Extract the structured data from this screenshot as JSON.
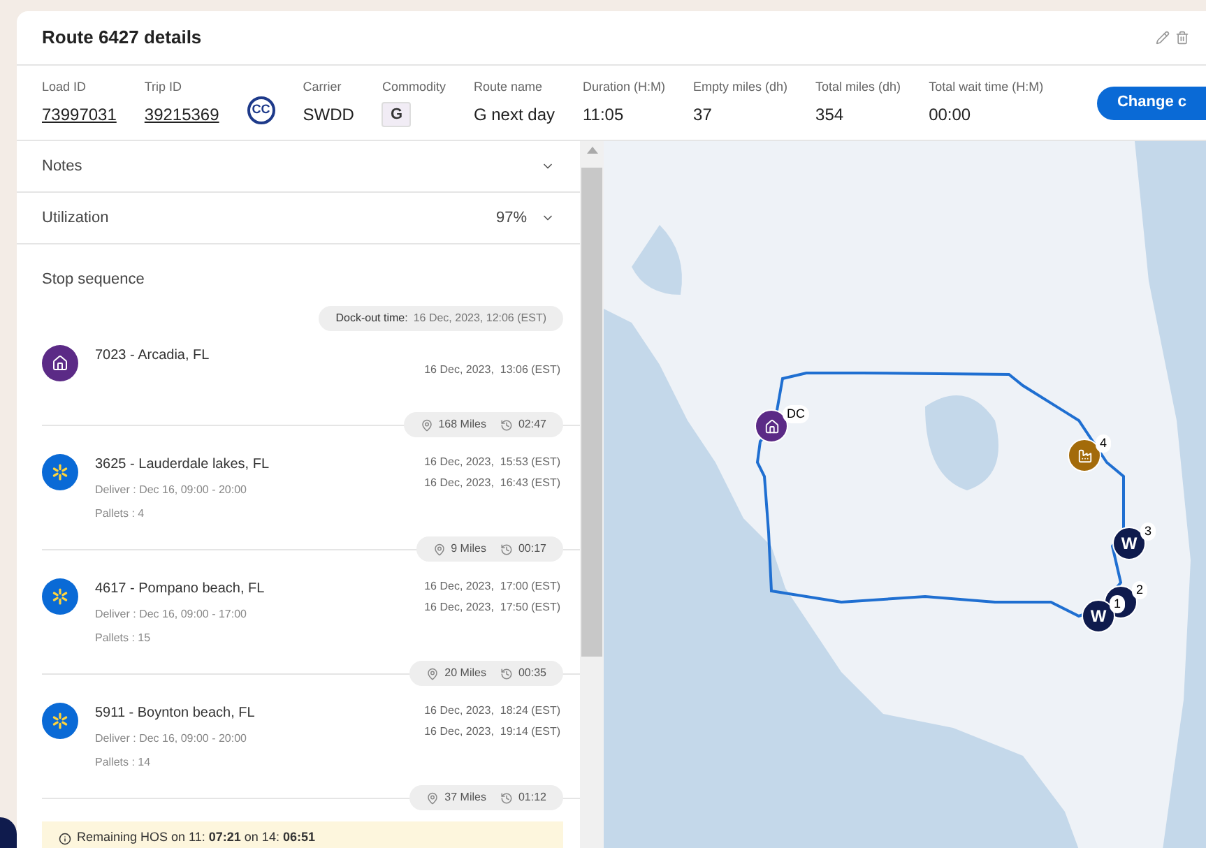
{
  "header": {
    "title": "Route 6427 details",
    "fields": [
      {
        "kind": "link",
        "label": "Load ID",
        "value": "73997031"
      },
      {
        "kind": "link",
        "label": "Trip ID",
        "value": "39215369"
      },
      {
        "kind": "logo",
        "value": "CC"
      },
      {
        "kind": "text",
        "label": "Carrier",
        "value": "SWDD"
      },
      {
        "kind": "badge",
        "label": "Commodity",
        "value": "G"
      },
      {
        "kind": "text",
        "label": "Route name",
        "value": "G next day"
      },
      {
        "kind": "text",
        "label": "Duration (H:M)",
        "value": "11:05"
      },
      {
        "kind": "text",
        "label": "Empty miles (dh)",
        "value": "37"
      },
      {
        "kind": "text",
        "label": "Total miles (dh)",
        "value": "354"
      },
      {
        "kind": "text",
        "label": "Total wait time (H:M)",
        "value": "00:00"
      }
    ],
    "button": "Change c"
  },
  "sections": [
    {
      "label": "Notes",
      "expanded": false
    },
    {
      "label": "Utilization",
      "value": "97%",
      "expanded": false
    }
  ],
  "stop_sequence": {
    "title": "Stop sequence",
    "dock_out": {
      "label": "Dock-out time:",
      "value": "16 Dec, 2023, 12:06 (EST)"
    },
    "stops": [
      {
        "kind": "dc",
        "name": "7023 - Arcadia, FL",
        "times": [
          "16 Dec, 2023,  13:06 (EST)"
        ],
        "leg": {
          "miles": "168 Miles",
          "time": "02:47"
        }
      },
      {
        "kind": "store",
        "name": "3625 - Lauderdale lakes, FL",
        "deliver": "Deliver : Dec 16, 09:00 - 20:00",
        "pallets": "Pallets : 4",
        "times": [
          "16 Dec, 2023,  15:53 (EST)",
          "16 Dec, 2023,  16:43 (EST)"
        ],
        "leg": {
          "miles": "9 Miles",
          "time": "00:17"
        }
      },
      {
        "kind": "store",
        "name": "4617 - Pompano beach, FL",
        "deliver": "Deliver : Dec 16, 09:00 - 17:00",
        "pallets": "Pallets : 15",
        "times": [
          "16 Dec, 2023,  17:00 (EST)",
          "16 Dec, 2023,  17:50 (EST)"
        ],
        "leg": {
          "miles": "20 Miles",
          "time": "00:35"
        }
      },
      {
        "kind": "store",
        "name": "5911 - Boynton beach, FL",
        "deliver": "Deliver : Dec 16, 09:00 - 20:00",
        "pallets": "Pallets : 14",
        "times": [
          "16 Dec, 2023,  18:24 (EST)",
          "16 Dec, 2023,  19:14 (EST)"
        ],
        "leg": {
          "miles": "37 Miles",
          "time": "01:12"
        }
      }
    ],
    "hos": "Remaining HOS on 11: **07:21** on 14: **06:51**"
  },
  "map": {
    "markers": [
      {
        "kind": "dc",
        "label": "DC"
      },
      {
        "kind": "supplier",
        "label": "4"
      },
      {
        "kind": "store",
        "glyph": "W",
        "label": "3"
      },
      {
        "kind": "store",
        "label": "2"
      },
      {
        "kind": "store",
        "glyph": "W",
        "label": "1"
      }
    ]
  }
}
